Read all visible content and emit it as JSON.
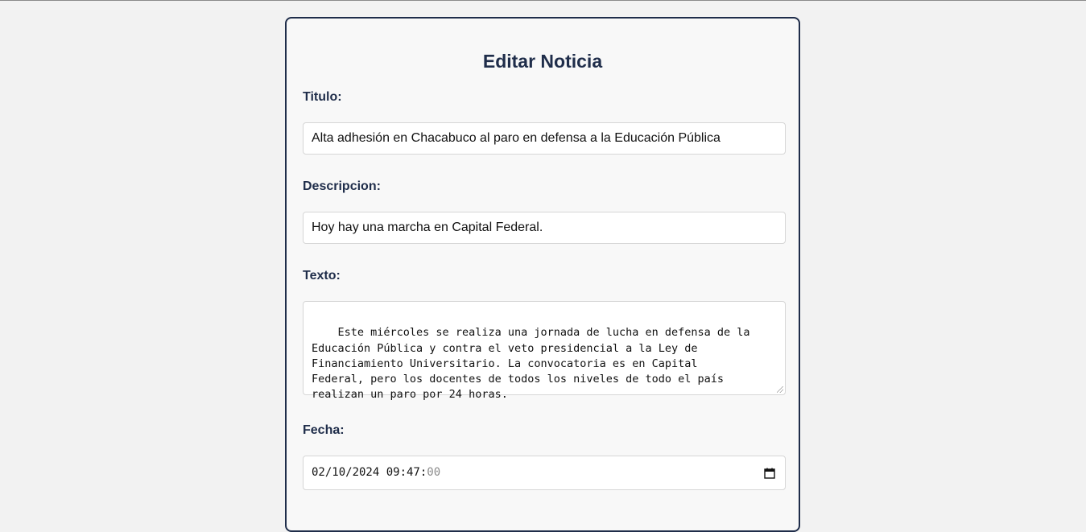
{
  "form": {
    "heading": "Editar Noticia",
    "titulo": {
      "label": "Titulo:",
      "value": "Alta adhesión en Chacabuco al paro en defensa a la Educación Pública"
    },
    "descripcion": {
      "label": "Descripcion:",
      "value": "Hoy hay una marcha en Capital Federal."
    },
    "texto": {
      "label": "Texto:",
      "value": "Este miércoles se realiza una jornada de lucha en defensa de la\nEducación Pública y contra el veto presidencial a la Ley de\nFinanciamiento Universitario. La convocatoria es en Capital\nFederal, pero los docentes de todos los niveles de todo el país\nrealizan un paro por 24 horas."
    },
    "fecha": {
      "label": "Fecha:",
      "value_main": "02/10/2024 09:47:",
      "value_seconds": "00"
    }
  },
  "icons": {
    "calendar": "calendar-icon",
    "resize": "resize-grip-icon"
  },
  "colors": {
    "accent": "#1f2d4a",
    "background": "#f2f2f2",
    "card": "#f8f8f8"
  }
}
